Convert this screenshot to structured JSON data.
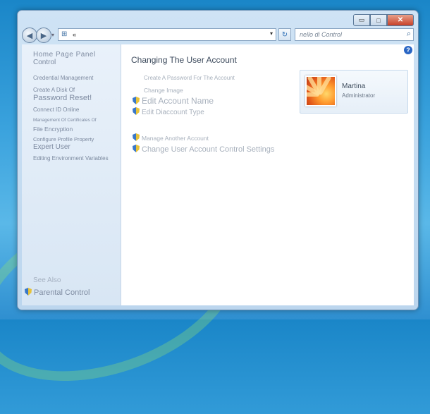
{
  "window": {
    "caption_buttons": {
      "minimize": "▭",
      "maximize": "□",
      "close": "✕"
    }
  },
  "navigation": {
    "back_icon": "◀",
    "forward_icon": "▶",
    "history_icon": "▾",
    "address_icon": "⊞",
    "address_text": "«",
    "address_dropdown_icon": "▾",
    "refresh_icon": "↻",
    "search_placeholder": "nello di Control",
    "search_icon": "⌕"
  },
  "sidebar": {
    "home_line1": "Home Page Panel",
    "home_line2": "Control",
    "items": [
      "Credential Management",
      "Create A Disk Of",
      "Password Reset!",
      "Connect ID Online",
      "Management Of Certificates Of",
      "File Encryption",
      "Configure Profile Property",
      "Expert User",
      "Editing Environment Variables"
    ],
    "see_also": "See Also",
    "parental_control": "Parental Control"
  },
  "main": {
    "help_icon": "?",
    "title": "Changing The User Account",
    "links": [
      "Create A Password For The Account",
      "Change Image",
      "Edit Account Name",
      "Edit Diaccount Type",
      "Manage Another Account",
      "Change User Account Control Settings"
    ]
  },
  "user": {
    "name": "Martina",
    "role": "Administrator"
  },
  "colors": {
    "desktop": "#1f8bd0",
    "window_frame": "#cfe3f5",
    "sidebar_bg": "#e4eef8",
    "link_text": "#a7b0bc",
    "shield_blue": "#3a78c8",
    "shield_yellow": "#e6c23a"
  }
}
